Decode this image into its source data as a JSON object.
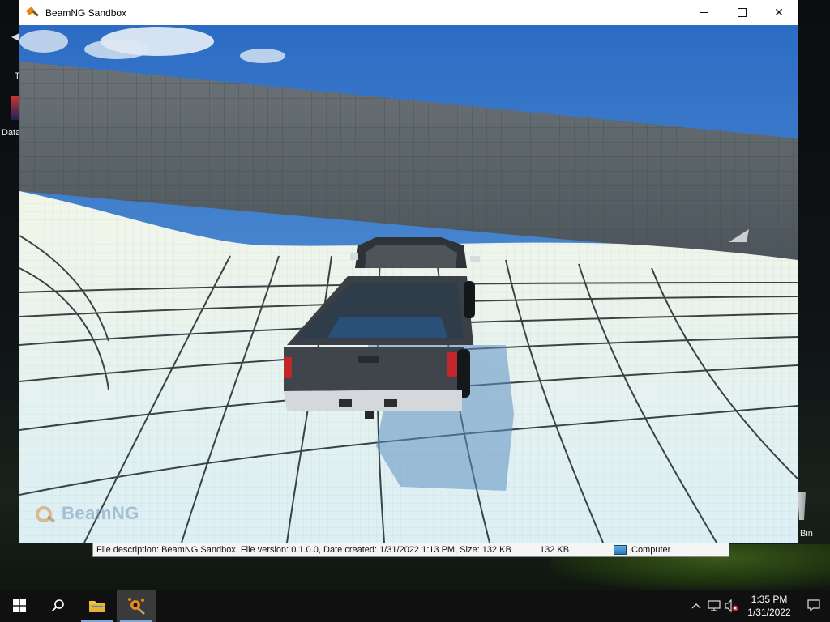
{
  "window": {
    "title": "BeamNG Sandbox",
    "controls": {
      "minimize": "minimize",
      "maximize": "maximize",
      "close": "close"
    }
  },
  "viewport": {
    "logo_text": "BeamNG"
  },
  "desktop": {
    "icon_label_left_top": "T",
    "icon_label_left": "Data",
    "icon_label_right": "Bin"
  },
  "tooltip": {
    "description": "File description: BeamNG Sandbox, File version: 0.1.0.0, Date created: 1/31/2022 1:13 PM, Size: 132 KB",
    "size": "132 KB",
    "location": "Computer"
  },
  "taskbar": {
    "time": "1:35 PM",
    "date": "1/31/2022",
    "items": [
      "start",
      "search",
      "file-explorer",
      "beamng-sandbox"
    ]
  },
  "colors": {
    "sky": "#3d7fd0",
    "ground": "#e8f3f3",
    "wall": "#5e666b",
    "truck": "#3a3f44",
    "taskbar": "#101010",
    "accent": "#7aa7d8"
  }
}
